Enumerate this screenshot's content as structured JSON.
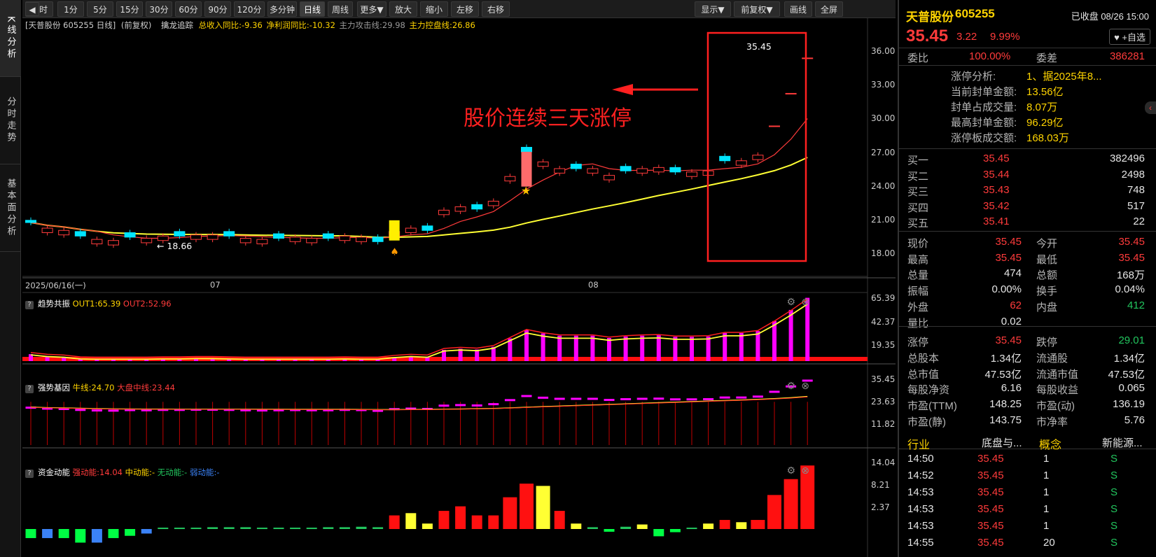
{
  "left_tabs": [
    "K线分析",
    "分时走势",
    "基本面分析"
  ],
  "toolbar": {
    "items": [
      "分时",
      "1分",
      "5分",
      "15分",
      "30分",
      "60分",
      "90分",
      "120分",
      "多分钟",
      "日线",
      "周线",
      "更多▼",
      "放大",
      "缩小",
      "左移",
      "右移",
      "显示▼",
      "前复权▼",
      "画线",
      "全屏"
    ],
    "active": "日线"
  },
  "main": {
    "title": "[天普股份 605255 日线]",
    "adjust": "(前复权)",
    "ind_name": "擒龙追踪",
    "stats": [
      "总收入同比:-9.36",
      "净利润同比:-10.32",
      "主力攻击线:29.98",
      "主力控盘线:26.86"
    ],
    "y_ticks": [
      "36.00",
      "33.00",
      "30.00",
      "27.00",
      "24.00",
      "21.00",
      "18.00"
    ],
    "x_labels": [
      "2025/06/16(一)",
      "07",
      "08"
    ],
    "low_label": "18.66",
    "high_label": "35.45",
    "annotation": "股价连续三天涨停"
  },
  "p1": {
    "name": "趋势共振",
    "items": [
      "OUT1:65.39",
      "OUT2:52.96"
    ],
    "y_ticks": [
      "65.39",
      "42.37",
      "19.35"
    ]
  },
  "p2": {
    "name": "强势基因",
    "items": [
      "牛线:24.70",
      "大盘中线:23.44"
    ],
    "y_ticks": [
      "35.45",
      "23.63",
      "11.82"
    ]
  },
  "p3": {
    "name": "资金动能",
    "items": [
      "强动能:14.04",
      "中动能:-",
      "无动能:-",
      "弱动能:-"
    ],
    "y_ticks": [
      "14.04",
      "8.21",
      "2.37"
    ]
  },
  "chart_data": {
    "type": "candlestick",
    "closes": [
      20.8,
      20.3,
      20.1,
      19.6,
      19.3,
      19.2,
      19.5,
      19.4,
      19.6,
      19.6,
      19.7,
      19.7,
      19.6,
      19.4,
      19.3,
      19.4,
      19.5,
      19.4,
      19.4,
      19.6,
      19.5,
      19.1,
      20.0,
      20.3,
      20.1,
      21.9,
      22.2,
      22.0,
      22.7,
      24.9,
      27.1,
      26.2,
      25.6,
      25.6,
      25.6,
      25.0,
      25.4,
      25.6,
      25.7,
      25.3,
      25.3,
      25.4,
      26.3,
      26.3,
      26.8,
      29.4,
      32.3,
      35.45
    ]
  },
  "quote": {
    "name": "天普股份",
    "code": "605255",
    "status": "已收盘 08/26 15:00",
    "price": "35.45",
    "change": "3.22",
    "pct": "9.99%",
    "fav": "+自选"
  },
  "ratio": {
    "wb_label": "委比",
    "wb": "100.00%",
    "wc_label": "委差",
    "wc": "386281"
  },
  "limit": [
    {
      "k": "涨停分析:",
      "v": "1、据2025年8..."
    },
    {
      "k": "当前封单金额:",
      "v": "13.56亿"
    },
    {
      "k": "封单占成交量:",
      "v": "8.07万"
    },
    {
      "k": "最高封单金额:",
      "v": "96.29亿"
    },
    {
      "k": "涨停板成交额:",
      "v": "168.03万"
    }
  ],
  "buys": [
    {
      "n": "买一",
      "p": "35.45",
      "v": "382496"
    },
    {
      "n": "买二",
      "p": "35.44",
      "v": "2498"
    },
    {
      "n": "买三",
      "p": "35.43",
      "v": "748"
    },
    {
      "n": "买四",
      "p": "35.42",
      "v": "517"
    },
    {
      "n": "买五",
      "p": "35.41",
      "v": "22"
    }
  ],
  "stats": [
    [
      "现价",
      "35.45",
      "今开",
      "35.45"
    ],
    [
      "最高",
      "35.45",
      "最低",
      "35.45"
    ],
    [
      "总量",
      "474",
      "总额",
      "168万"
    ],
    [
      "振幅",
      "0.00%",
      "换手",
      "0.04%"
    ],
    [
      "外盘",
      "62",
      "内盘",
      "412"
    ],
    [
      "量比",
      "0.02",
      "",
      ""
    ],
    [
      "涨停",
      "35.45",
      "跌停",
      "29.01"
    ],
    [
      "总股本",
      "1.34亿",
      "流通股",
      "1.34亿"
    ],
    [
      "总市值",
      "47.53亿",
      "流通市值",
      "47.53亿"
    ],
    [
      "每股净资",
      "6.16",
      "每股收益",
      "0.065"
    ],
    [
      "市盈(TTM)",
      "148.25",
      "市盈(动)",
      "136.19"
    ],
    [
      "市盈(静)",
      "143.75",
      "市净率",
      "5.76"
    ]
  ],
  "industry": {
    "k1": "行业",
    "v1": "底盘与...",
    "k2": "概念",
    "v2": "新能源..."
  },
  "ticks": [
    {
      "t": "14:50",
      "p": "35.45",
      "v": "1",
      "s": "S"
    },
    {
      "t": "14:52",
      "p": "35.45",
      "v": "1",
      "s": "S"
    },
    {
      "t": "14:53",
      "p": "35.45",
      "v": "1",
      "s": "S"
    },
    {
      "t": "14:53",
      "p": "35.45",
      "v": "1",
      "s": "S"
    },
    {
      "t": "14:53",
      "p": "35.45",
      "v": "1",
      "s": "S"
    },
    {
      "t": "14:55",
      "p": "35.45",
      "v": "20",
      "s": "S"
    }
  ]
}
